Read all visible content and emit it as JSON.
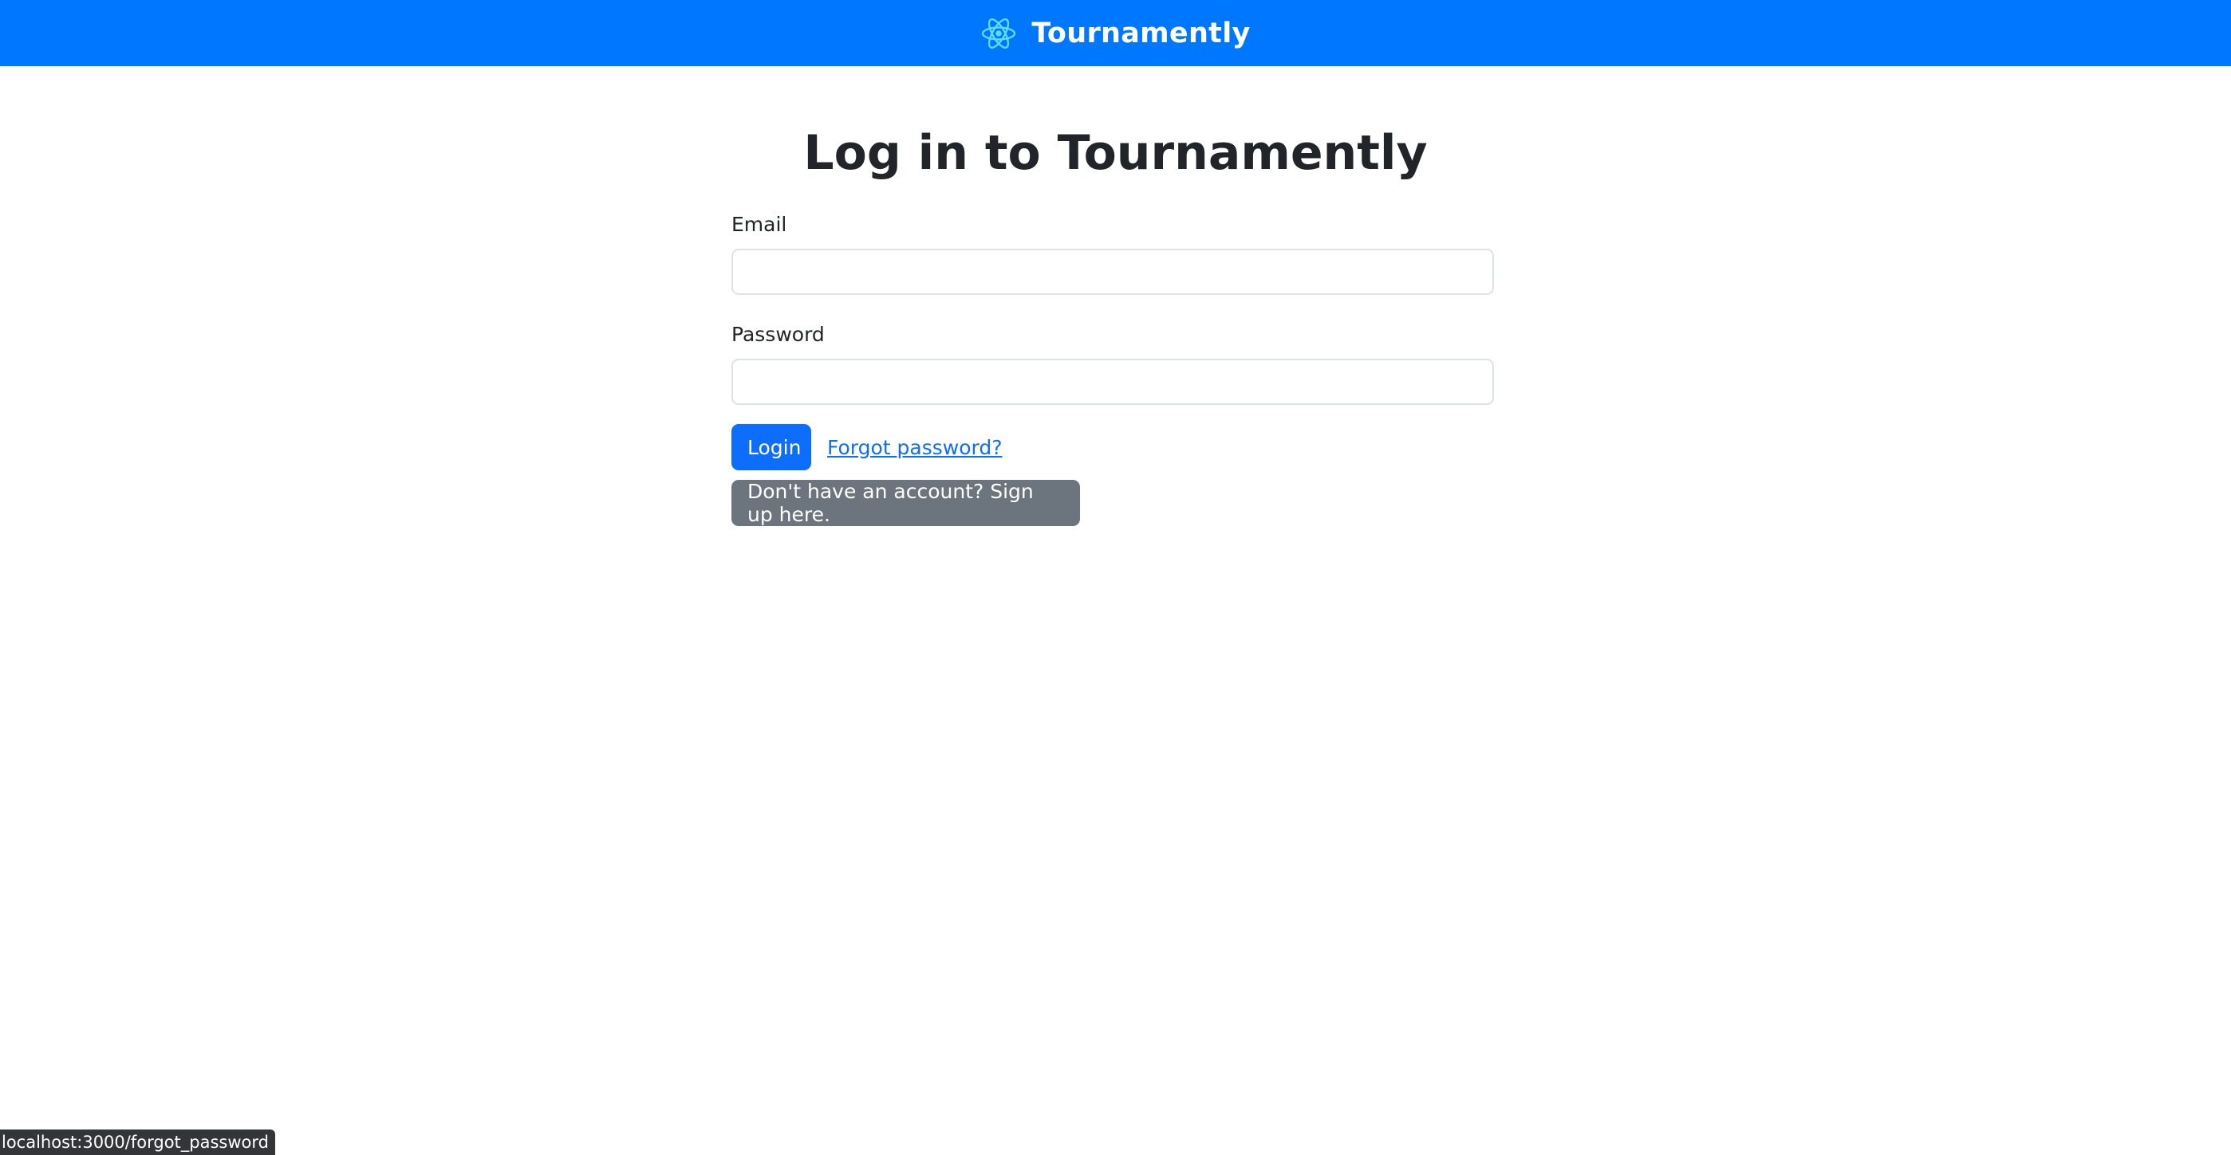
{
  "navbar": {
    "brand_name": "Tournamently",
    "logo_icon": "react-atom-icon",
    "background_color": "#0077ff",
    "logo_color": "#61dafb"
  },
  "page": {
    "title": "Log in to Tournamently"
  },
  "form": {
    "email_label": "Email",
    "email_value": "",
    "password_label": "Password",
    "password_value": "",
    "login_button_label": "Login",
    "forgot_password_link": "Forgot password?",
    "signup_button_label": "Don't have an account? Sign up here."
  },
  "colors": {
    "primary": "#0d6efd",
    "secondary": "#6c757d",
    "text": "#212529"
  },
  "status_bar": {
    "url": "localhost:3000/forgot_password"
  }
}
